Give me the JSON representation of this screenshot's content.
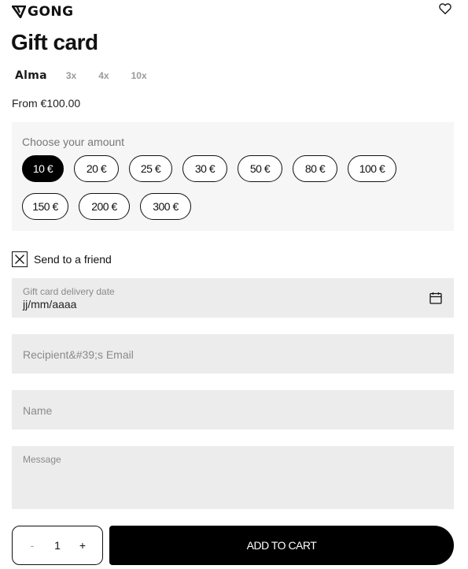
{
  "brand": {
    "name": "GONG",
    "logo_icon": "gong-logo-icon"
  },
  "header": {
    "wishlist_icon": "heart-icon"
  },
  "product": {
    "title": "Gift card",
    "price_text": "From €100.00"
  },
  "payment_options": {
    "provider": "Alma",
    "installments": [
      "3x",
      "4x",
      "10x"
    ]
  },
  "amount_selector": {
    "label": "Choose your amount",
    "options": [
      "10 €",
      "20 €",
      "25 €",
      "30 €",
      "50 €",
      "80 €",
      "100 €",
      "150 €",
      "200 €",
      "300 €"
    ],
    "selected": "10 €"
  },
  "send_to_friend": {
    "label": "Send to a friend",
    "checked": true
  },
  "form": {
    "delivery_date": {
      "label": "Gift card delivery date",
      "value": "jj/mm/aaaa",
      "icon": "calendar-icon"
    },
    "recipient_email": {
      "placeholder": "Recipient&#39;s Email"
    },
    "name": {
      "placeholder": "Name"
    },
    "message": {
      "label": "Message"
    }
  },
  "cart": {
    "decrement": "-",
    "quantity": "1",
    "increment": "+",
    "add_label": "ADD TO CART"
  },
  "colors": {
    "accent": "#000000",
    "panel_bg": "#f6f6f6",
    "field_bg": "#ececec"
  }
}
